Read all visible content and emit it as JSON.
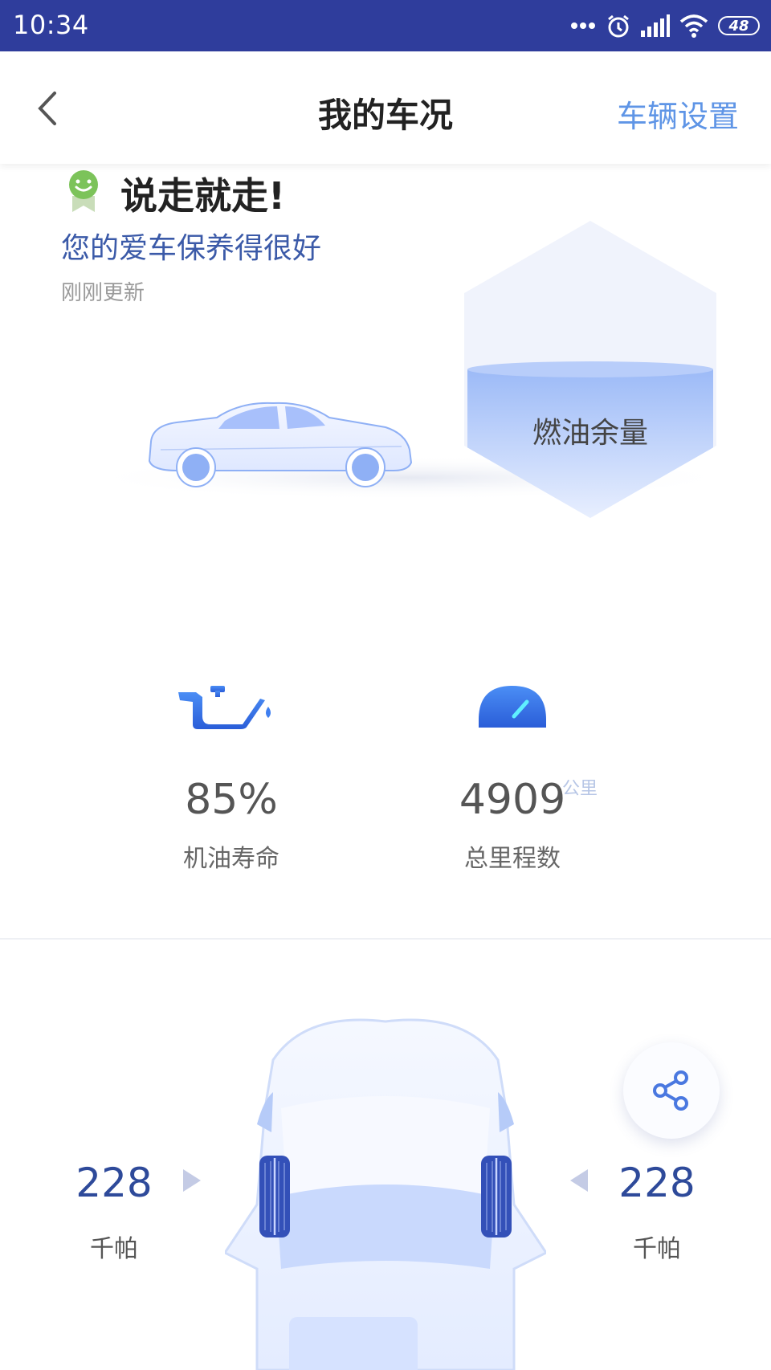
{
  "status_bar": {
    "time": "10:34",
    "battery": "48",
    "icons": [
      "more-dots-icon",
      "alarm-icon",
      "signal-icon",
      "wifi-icon",
      "battery-icon"
    ]
  },
  "nav": {
    "title": "我的车况",
    "right_action": "车辆设置",
    "back_icon": "back-chevron-icon"
  },
  "vehicle_status": {
    "headline": "说走就走!",
    "subline": "您的爱车保养得很好",
    "updated": "刚刚更新"
  },
  "fuel": {
    "label": "燃油余量"
  },
  "stats": {
    "oil": {
      "value": "85%",
      "label": "机油寿命",
      "icon": "oil-can-icon"
    },
    "mileage": {
      "value": "4909",
      "unit": "公里",
      "label": "总里程数",
      "icon": "speedometer-icon"
    }
  },
  "tires": {
    "left": {
      "value": "228",
      "unit": "千帕"
    },
    "right": {
      "value": "228",
      "unit": "千帕"
    }
  },
  "colors": {
    "status_bar": "#2f3d9c",
    "accent": "#5f95e6",
    "pressure": "#2e4a9a"
  }
}
